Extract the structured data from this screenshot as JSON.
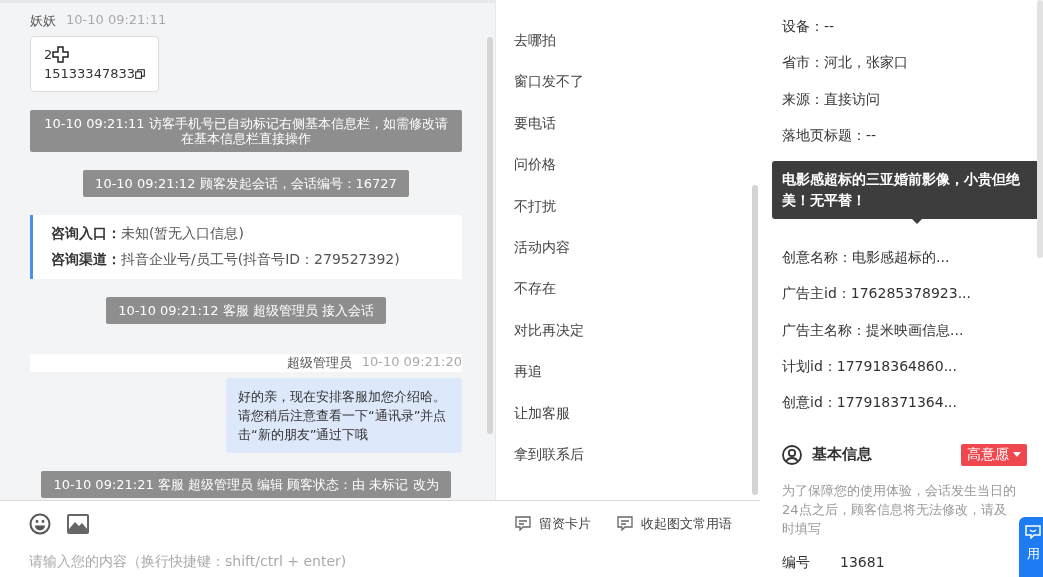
{
  "chat": {
    "messages": [
      {
        "kind": "visitor",
        "sender": "妖妖",
        "time": "10-10 09:21:11",
        "lines": [
          "2",
          "15133347833"
        ]
      },
      {
        "kind": "system",
        "text": "10-10 09:21:11 访客手机号已自动标记右侧基本信息栏，如需修改请在基本信息栏直接操作"
      },
      {
        "kind": "system",
        "text": "10-10 09:21:12 顾客发起会话，会话编号：16727"
      },
      {
        "kind": "info",
        "rows": [
          {
            "label": "咨询入口：",
            "value": "未知(暂无入口信息)"
          },
          {
            "label": "咨询渠道：",
            "value": "抖音企业号/员工号(抖音号ID：279527392)"
          }
        ]
      },
      {
        "kind": "system",
        "text": "10-10 09:21:12 客服 超级管理员 接入会话"
      },
      {
        "kind": "agent",
        "sender": "超级管理员",
        "time": "10-10 09:21:20",
        "text": "好的亲，现在安排客服加您介绍哈。请您稍后注意查看一下“通讯录”并点击“新的朋友”通过下哦"
      },
      {
        "kind": "system",
        "text": "10-10 09:21:21 客服 超级管理员 编辑 顾客状态：由 未标记 改为"
      }
    ]
  },
  "composer": {
    "placeholder": "请输入您的内容（换行快捷键：shift/ctrl + enter)"
  },
  "phrases": {
    "items": [
      "去哪拍",
      "窗口发不了",
      "要电话",
      "问价格",
      "不打扰",
      "活动内容",
      "不存在",
      "对比再决定",
      "再追",
      "让加客服",
      "拿到联系后"
    ],
    "actions": [
      "留资卡片",
      "收起图文常用语"
    ]
  },
  "source_info": {
    "fields": [
      {
        "label": "设备：",
        "value": "--"
      },
      {
        "label": "省市：",
        "value": "河北，张家口"
      },
      {
        "label": "来源：",
        "value": "直接访问"
      },
      {
        "label": "落地页标题：",
        "value": "--"
      },
      {
        "label": "创意名称：",
        "value": "电影感超标的..."
      },
      {
        "label": "广告主id：",
        "value": "176285378923..."
      },
      {
        "label": "广告主名称：",
        "value": "提米映画信息..."
      },
      {
        "label": "计划id：",
        "value": "177918364860..."
      },
      {
        "label": "创意id：",
        "value": "177918371364..."
      }
    ],
    "tooltip": "电影感超标的三亚婚前影像，小贵但绝美！无平替！"
  },
  "basic_info": {
    "title": "基本信息",
    "intent": "高意愿",
    "notice": "为了保障您的使用体验，会话发生当日的24点之后，顾客信息将无法修改，请及时填写",
    "fields": [
      {
        "label": "编号",
        "value": "13681"
      }
    ]
  },
  "float_button": {
    "label": "用"
  }
}
